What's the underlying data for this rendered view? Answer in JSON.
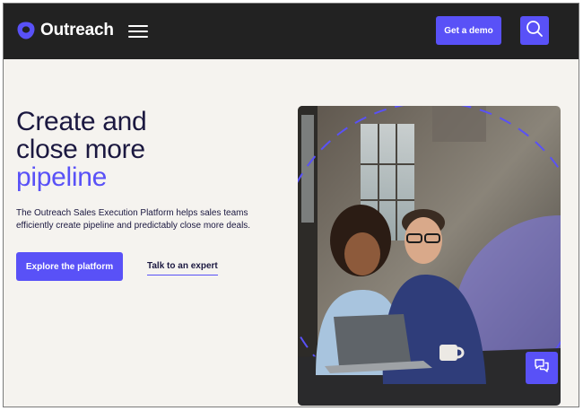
{
  "header": {
    "brand": "Outreach",
    "demo_label": "Get a demo"
  },
  "hero": {
    "headline_line1": "Create and",
    "headline_line2": "close more",
    "headline_accent": "pipeline",
    "description": "The Outreach Sales Execution Platform helps sales teams efficiently create pipeline and predictably close more deals.",
    "primary_cta": "Explore the platform",
    "secondary_cta": "Talk to an expert"
  },
  "icons": {
    "logo": "outreach-logo-icon",
    "menu": "hamburger-menu-icon",
    "search": "search-icon",
    "chat": "chat-bubbles-icon"
  },
  "colors": {
    "accent": "#5951f7",
    "header_bg": "#222222",
    "page_bg": "#f5f3ef",
    "headline": "#1b1840"
  }
}
